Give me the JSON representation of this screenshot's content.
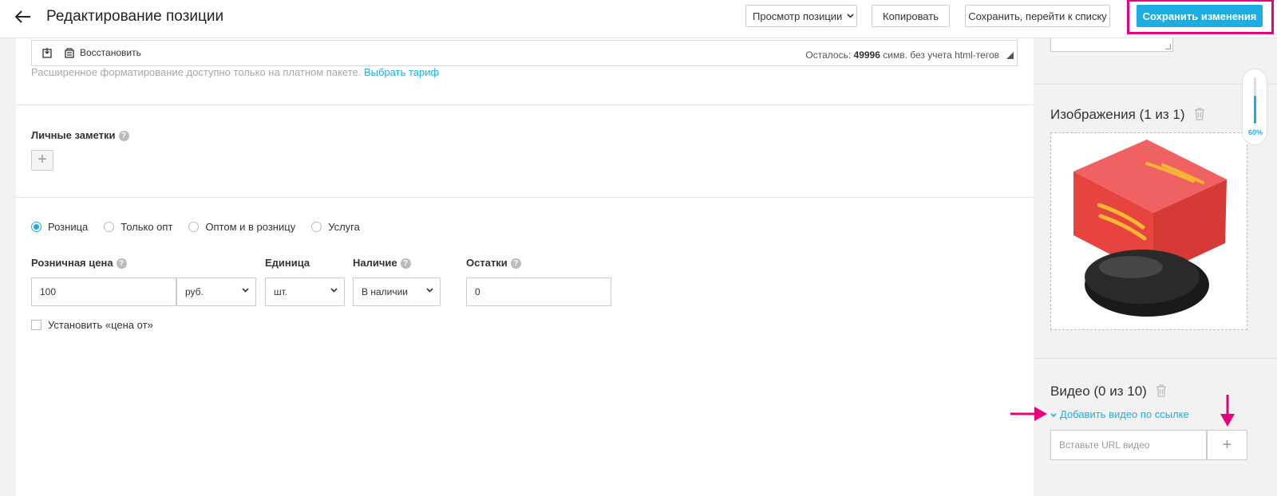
{
  "header": {
    "title": "Редактирование позиции",
    "view_select": "Просмотр позиции",
    "copy_label": "Копировать",
    "save_list_label": "Сохранить, перейти к списку",
    "save_label": "Сохранить изменения"
  },
  "editor": {
    "restore_label": "Восстановить",
    "remaining_prefix": "Осталось:",
    "remaining_count": "49996",
    "remaining_suffix": "симв. без учета html-тегов",
    "note": "Расширенное форматирование доступно только на платном пакете.",
    "note_link": "Выбрать тариф"
  },
  "notes": {
    "label": "Личные заметки",
    "help": "?",
    "add": "+"
  },
  "sale_type": {
    "options": [
      "Розница",
      "Только опт",
      "Оптом и в розницу",
      "Услуга"
    ],
    "selected": "Розница"
  },
  "price": {
    "retail_label": "Розничная цена",
    "retail_value": "100",
    "currency": "руб.",
    "unit_label": "Единица",
    "unit_value": "шт.",
    "availability_label": "Наличие",
    "availability_value": "В наличии",
    "stock_label": "Остатки",
    "stock_value": "0",
    "help": "?",
    "price_from_label": "Установить «цена от»"
  },
  "images": {
    "title": "Изображения (1 из 1)",
    "zoom": "60%",
    "zoom_level": 0.6
  },
  "video": {
    "title": "Видео (0 из 10)",
    "add_link": "Добавить видео по ссылке",
    "url_placeholder": "Вставьте URL видео",
    "add": "+"
  },
  "colors": {
    "accent": "#1aaee4",
    "highlight": "#e6007e"
  }
}
